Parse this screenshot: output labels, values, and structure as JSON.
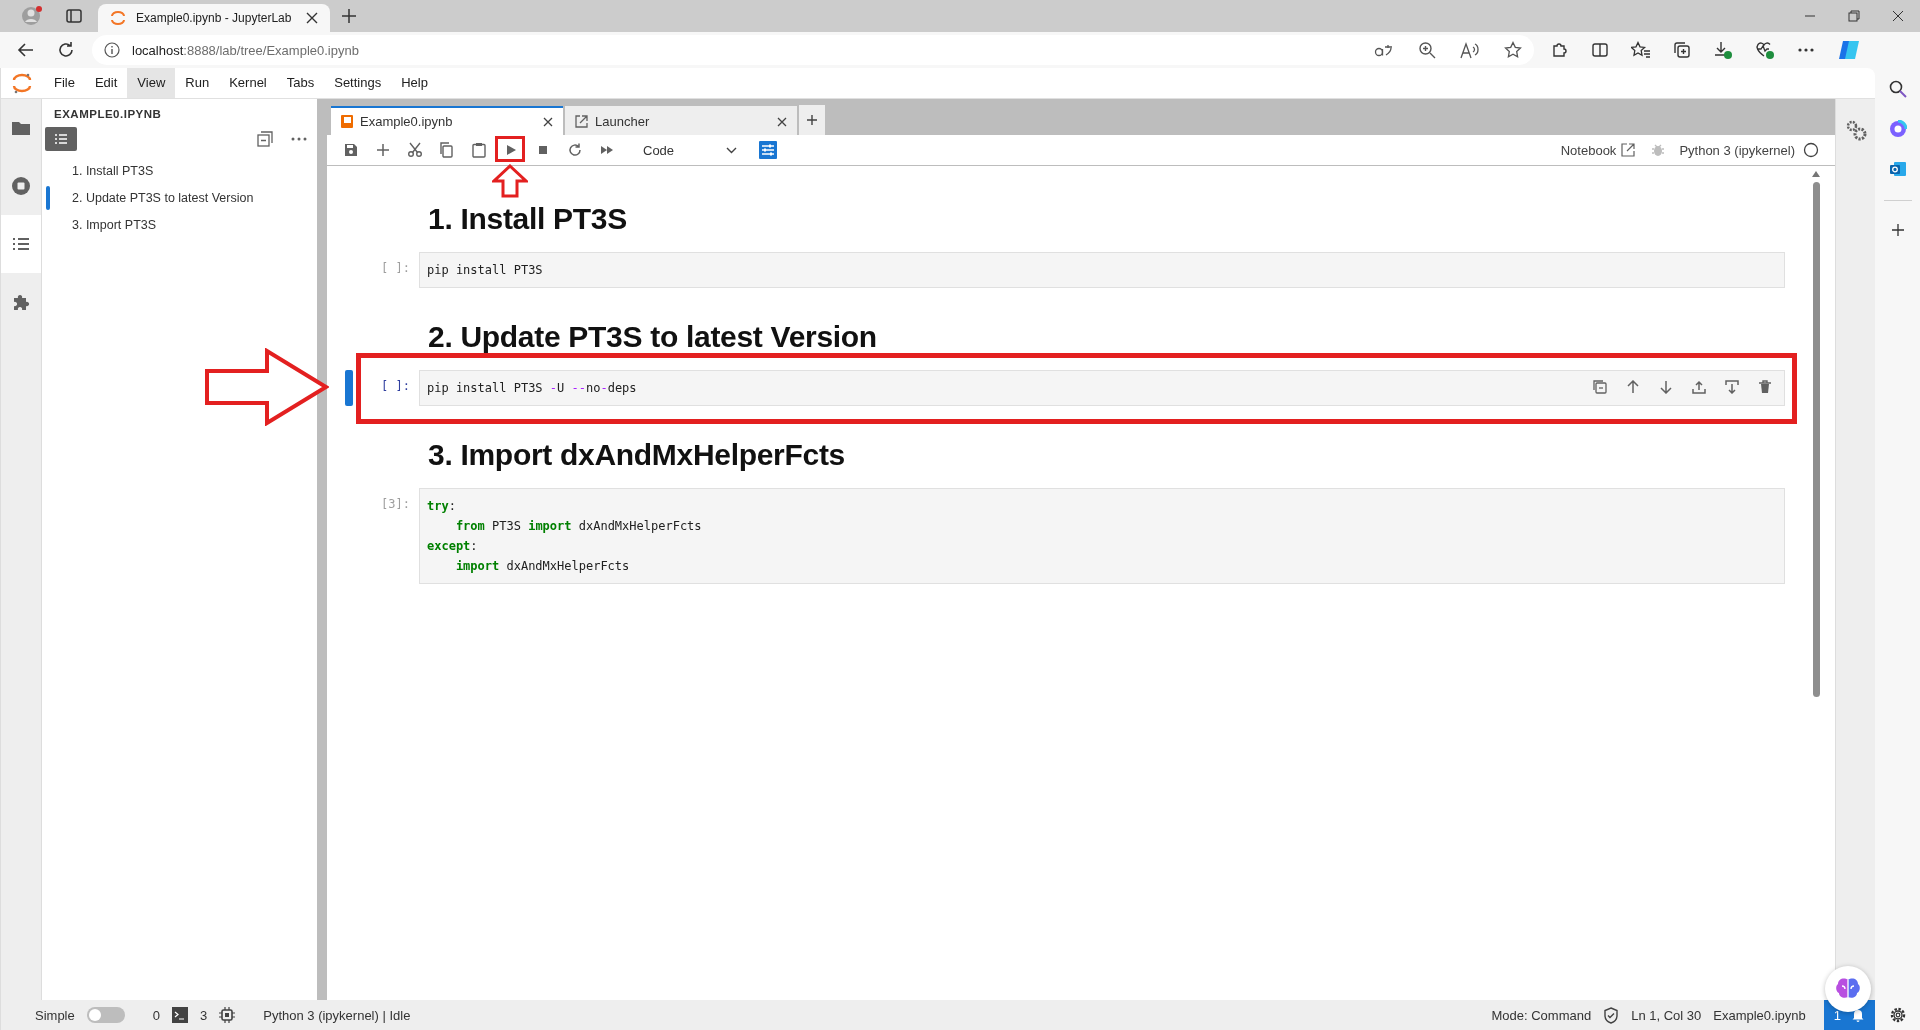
{
  "browser": {
    "tab_title": "Example0.ipynb - JupyterLab",
    "url_host": "localhost",
    "url_path": ":8888/lab/tree/Example0.ipynb"
  },
  "menu": [
    {
      "label": "File",
      "selected": false
    },
    {
      "label": "Edit",
      "selected": false
    },
    {
      "label": "View",
      "selected": true
    },
    {
      "label": "Run",
      "selected": false
    },
    {
      "label": "Kernel",
      "selected": false
    },
    {
      "label": "Tabs",
      "selected": false
    },
    {
      "label": "Settings",
      "selected": false
    },
    {
      "label": "Help",
      "selected": false
    }
  ],
  "activity_bar": [
    {
      "kind": "files",
      "selected": false
    },
    {
      "kind": "running",
      "selected": false
    },
    {
      "kind": "toc",
      "selected": true
    },
    {
      "kind": "extensions",
      "selected": false
    }
  ],
  "sidebar": {
    "title": "EXAMPLE0.IPYNB",
    "items": [
      {
        "label": "1. Install PT3S",
        "selected": false
      },
      {
        "label": "2. Update PT3S to latest Version",
        "selected": true
      },
      {
        "label": "3. Import PT3S",
        "selected": false
      }
    ]
  },
  "tabs": [
    {
      "label": "Example0.ipynb",
      "kind": "notebook",
      "selected": true
    },
    {
      "label": "Launcher",
      "kind": "launcher",
      "selected": false
    }
  ],
  "toolbar": {
    "cell_type": "Code",
    "run_highlighted": true,
    "notebook_link": "Notebook",
    "kernel": "Python 3 (ipykernel)"
  },
  "cells": [
    {
      "kind": "markdown",
      "text": "1. Install PT3S"
    },
    {
      "kind": "code",
      "prompt": "[ ]:",
      "selected": false,
      "highlighted": false,
      "lines": [
        [
          {
            "text": "pip install PT3S",
            "kind": "plain"
          }
        ]
      ]
    },
    {
      "kind": "markdown",
      "text": "2. Update PT3S to latest Version"
    },
    {
      "kind": "code",
      "prompt": "[ ]:",
      "selected": true,
      "highlighted": true,
      "lines": [
        [
          {
            "text": "pip install PT3S ",
            "kind": "plain"
          },
          {
            "text": "-",
            "kind": "operator"
          },
          {
            "text": "U ",
            "kind": "plain"
          },
          {
            "text": "--",
            "kind": "operator"
          },
          {
            "text": "no",
            "kind": "plain"
          },
          {
            "text": "-",
            "kind": "operator"
          },
          {
            "text": "deps",
            "kind": "plain"
          }
        ]
      ]
    },
    {
      "kind": "markdown",
      "text": "3. Import dxAndMxHelperFcts"
    },
    {
      "kind": "code",
      "prompt": "[3]:",
      "selected": false,
      "highlighted": false,
      "lines": [
        [
          {
            "text": "try",
            "kind": "keyword"
          },
          {
            "text": ":",
            "kind": "plain"
          }
        ],
        [
          {
            "text": "    from",
            "kind": "keyword"
          },
          {
            "text": " PT3S ",
            "kind": "plain"
          },
          {
            "text": "import",
            "kind": "keyword"
          },
          {
            "text": " dxAndMxHelperFcts",
            "kind": "plain"
          }
        ],
        [
          {
            "text": "except",
            "kind": "keyword"
          },
          {
            "text": ":",
            "kind": "plain"
          }
        ],
        [
          {
            "text": "    import",
            "kind": "keyword"
          },
          {
            "text": " dxAndMxHelperFcts",
            "kind": "plain"
          }
        ]
      ]
    }
  ],
  "status_bar": {
    "mode_label": "Simple",
    "simple_on": false,
    "terminals": "0",
    "kernels": "3",
    "kernel_status": "Python 3 (ipykernel) | Idle",
    "mode": "Mode: Command",
    "position": "Ln 1, Col 30",
    "file": "Example0.ipynb",
    "notifications": "1"
  }
}
